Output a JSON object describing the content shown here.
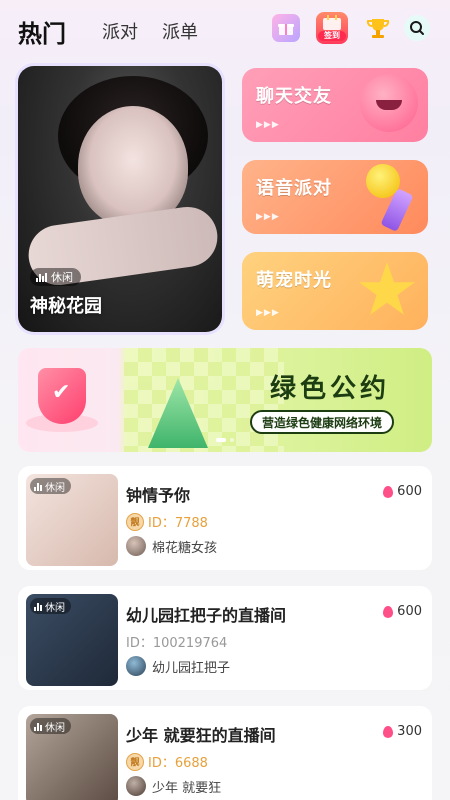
{
  "header": {
    "tabs": [
      {
        "label": "热门",
        "active": true
      },
      {
        "label": "派对",
        "active": false
      },
      {
        "label": "派单",
        "active": false
      }
    ],
    "icons": [
      "gift-icon",
      "checkin-icon",
      "trophy-icon",
      "search-icon"
    ],
    "checkin_label": "签到"
  },
  "hero": {
    "tag": "休闲",
    "title": "神秘花园"
  },
  "categories": [
    {
      "label": "聊天交友"
    },
    {
      "label": "语音派对"
    },
    {
      "label": "萌宠时光"
    }
  ],
  "banner": {
    "title": "绿色公约",
    "subtitle": "营造绿色健康网络环境"
  },
  "rooms": [
    {
      "tag": "休闲",
      "name": "钟情予你",
      "heat": "600",
      "id": "ID：7788",
      "id_style": "gold",
      "owner": "棉花糖女孩"
    },
    {
      "tag": "休闲",
      "name": "幼儿园扛把子的直播间",
      "heat": "600",
      "id": "ID：100219764",
      "id_style": "plain",
      "owner": "幼儿园扛把子"
    },
    {
      "tag": "休闲",
      "name": "少年 就要狂的直播间",
      "heat": "300",
      "id": "ID：6688",
      "id_style": "gold",
      "owner": "少年 就要狂"
    }
  ]
}
